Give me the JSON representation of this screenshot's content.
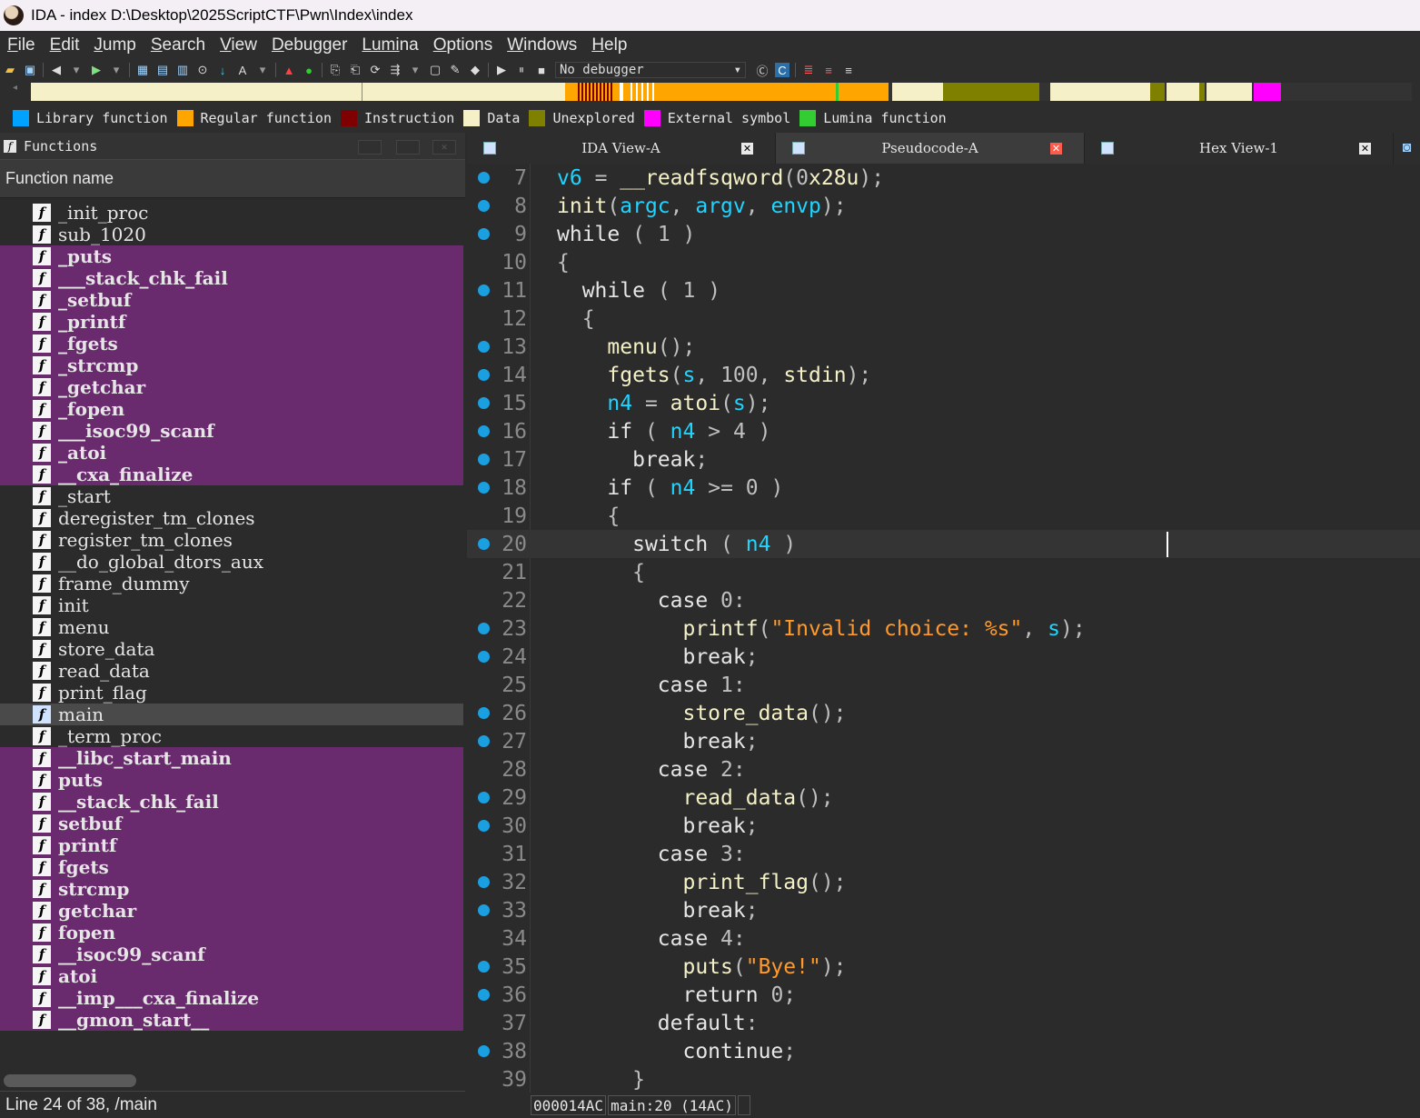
{
  "window": {
    "title": "IDA - index D:\\Desktop\\2025ScriptCTF\\Pwn\\Index\\index"
  },
  "menu": {
    "items": [
      {
        "label": "File",
        "key": "F",
        "rest": "ile"
      },
      {
        "label": "Edit",
        "key": "E",
        "rest": "dit"
      },
      {
        "label": "Jump",
        "key": "J",
        "rest": "ump"
      },
      {
        "label": "Search",
        "key": "S",
        "rest": "earch"
      },
      {
        "label": "View",
        "key": "V",
        "rest": "iew"
      },
      {
        "label": "Debugger",
        "key": "D",
        "rest": "ebugger"
      },
      {
        "label": "Lumina",
        "key": "Lumi",
        "rest": "na"
      },
      {
        "label": "Options",
        "key": "O",
        "rest": "ptions"
      },
      {
        "label": "Windows",
        "key": "W",
        "rest": "indows"
      },
      {
        "label": "Help",
        "key": "H",
        "rest": "elp"
      }
    ]
  },
  "toolbar": {
    "debugger": "No debugger"
  },
  "legend": [
    {
      "label": "Library function",
      "color": "#00a2ff"
    },
    {
      "label": "Regular function",
      "color": "#ffa500"
    },
    {
      "label": "Instruction",
      "color": "#7f0000"
    },
    {
      "label": "Data",
      "color": "#f5f0c8"
    },
    {
      "label": "Unexplored",
      "color": "#7f7f00"
    },
    {
      "label": "External symbol",
      "color": "#ff00ff"
    },
    {
      "label": "Lumina function",
      "color": "#33cc33"
    }
  ],
  "functions_panel": {
    "title": "Functions",
    "column": "Function name",
    "status": "Line 24 of 38, /main",
    "items": [
      {
        "name": "_init_proc",
        "kind": "regular"
      },
      {
        "name": "sub_1020",
        "kind": "regular"
      },
      {
        "name": "_puts",
        "kind": "import"
      },
      {
        "name": "___stack_chk_fail",
        "kind": "import"
      },
      {
        "name": "_setbuf",
        "kind": "import"
      },
      {
        "name": "_printf",
        "kind": "import"
      },
      {
        "name": "_fgets",
        "kind": "import"
      },
      {
        "name": "_strcmp",
        "kind": "import"
      },
      {
        "name": "_getchar",
        "kind": "import"
      },
      {
        "name": "_fopen",
        "kind": "import"
      },
      {
        "name": "___isoc99_scanf",
        "kind": "import"
      },
      {
        "name": "_atoi",
        "kind": "import"
      },
      {
        "name": "__cxa_finalize",
        "kind": "import"
      },
      {
        "name": "_start",
        "kind": "regular"
      },
      {
        "name": "deregister_tm_clones",
        "kind": "regular"
      },
      {
        "name": "register_tm_clones",
        "kind": "regular"
      },
      {
        "name": "__do_global_dtors_aux",
        "kind": "regular"
      },
      {
        "name": "frame_dummy",
        "kind": "regular"
      },
      {
        "name": "init",
        "kind": "regular"
      },
      {
        "name": "menu",
        "kind": "regular"
      },
      {
        "name": "store_data",
        "kind": "regular"
      },
      {
        "name": "read_data",
        "kind": "regular"
      },
      {
        "name": "print_flag",
        "kind": "regular"
      },
      {
        "name": "main",
        "kind": "selected"
      },
      {
        "name": "_term_proc",
        "kind": "regular"
      },
      {
        "name": "__libc_start_main",
        "kind": "import"
      },
      {
        "name": "puts",
        "kind": "import"
      },
      {
        "name": "__stack_chk_fail",
        "kind": "import"
      },
      {
        "name": "setbuf",
        "kind": "import"
      },
      {
        "name": "printf",
        "kind": "import"
      },
      {
        "name": "fgets",
        "kind": "import"
      },
      {
        "name": "strcmp",
        "kind": "import"
      },
      {
        "name": "getchar",
        "kind": "import"
      },
      {
        "name": "fopen",
        "kind": "import"
      },
      {
        "name": "__isoc99_scanf",
        "kind": "import"
      },
      {
        "name": "atoi",
        "kind": "import"
      },
      {
        "name": "__imp___cxa_finalize",
        "kind": "import"
      },
      {
        "name": "__gmon_start__",
        "kind": "import"
      }
    ]
  },
  "tabs": [
    {
      "label": "IDA View-A",
      "active": false,
      "icon": "listing-icon"
    },
    {
      "label": "Pseudocode-A",
      "active": true,
      "icon": "pseudocode-icon"
    },
    {
      "label": "Hex View-1",
      "active": false,
      "icon": "hex-icon"
    }
  ],
  "code": {
    "status": {
      "address": "000014AC",
      "location": "main:20 (14AC)"
    },
    "current_line": 20,
    "lines": [
      {
        "n": "7",
        "dot": true,
        "text": "v6 = __readfsqword(0x28u);"
      },
      {
        "n": "8",
        "dot": true,
        "text": "init(argc, argv, envp);"
      },
      {
        "n": "9",
        "dot": true,
        "text": "while ( 1 )"
      },
      {
        "n": "10",
        "dot": false,
        "text": "{"
      },
      {
        "n": "11",
        "dot": true,
        "text": "  while ( 1 )"
      },
      {
        "n": "12",
        "dot": false,
        "text": "  {"
      },
      {
        "n": "13",
        "dot": true,
        "text": "    menu();"
      },
      {
        "n": "14",
        "dot": true,
        "text": "    fgets(s, 100, stdin);"
      },
      {
        "n": "15",
        "dot": true,
        "text": "    n4 = atoi(s);"
      },
      {
        "n": "16",
        "dot": true,
        "text": "    if ( n4 > 4 )"
      },
      {
        "n": "17",
        "dot": true,
        "text": "      break;"
      },
      {
        "n": "18",
        "dot": true,
        "text": "    if ( n4 >= 0 )"
      },
      {
        "n": "19",
        "dot": false,
        "text": "    {"
      },
      {
        "n": "20",
        "dot": true,
        "text": "      switch ( n4 )"
      },
      {
        "n": "21",
        "dot": false,
        "text": "      {"
      },
      {
        "n": "22",
        "dot": false,
        "text": "        case 0:"
      },
      {
        "n": "23",
        "dot": true,
        "text": "          printf(\"Invalid choice: %s\", s);"
      },
      {
        "n": "24",
        "dot": true,
        "text": "          break;"
      },
      {
        "n": "25",
        "dot": false,
        "text": "        case 1:"
      },
      {
        "n": "26",
        "dot": true,
        "text": "          store_data();"
      },
      {
        "n": "27",
        "dot": true,
        "text": "          break;"
      },
      {
        "n": "28",
        "dot": false,
        "text": "        case 2:"
      },
      {
        "n": "29",
        "dot": true,
        "text": "          read_data();"
      },
      {
        "n": "30",
        "dot": true,
        "text": "          break;"
      },
      {
        "n": "31",
        "dot": false,
        "text": "        case 3:"
      },
      {
        "n": "32",
        "dot": true,
        "text": "          print_flag();"
      },
      {
        "n": "33",
        "dot": true,
        "text": "          break;"
      },
      {
        "n": "34",
        "dot": false,
        "text": "        case 4:"
      },
      {
        "n": "35",
        "dot": true,
        "text": "          puts(\"Bye!\");"
      },
      {
        "n": "36",
        "dot": true,
        "text": "          return 0;"
      },
      {
        "n": "37",
        "dot": false,
        "text": "        default:"
      },
      {
        "n": "38",
        "dot": true,
        "text": "          continue;"
      },
      {
        "n": "39",
        "dot": false,
        "text": "      }"
      }
    ]
  }
}
